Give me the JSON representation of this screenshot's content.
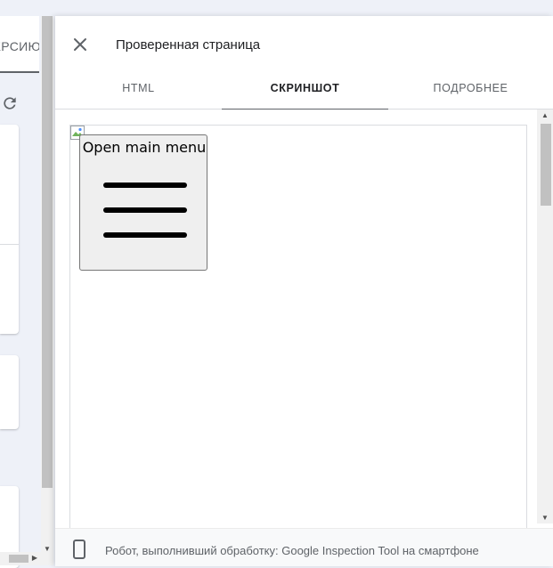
{
  "background_page": {
    "tab_label": "ЕРСИЮ",
    "icons": [
      "refresh-icon"
    ]
  },
  "panel": {
    "title": "Проверенная страница",
    "tabs": [
      {
        "label": "HTML",
        "active": false
      },
      {
        "label": "СКРИНШОТ",
        "active": true
      },
      {
        "label": "ПОДРОБНЕЕ",
        "active": false
      }
    ],
    "screenshot": {
      "menu_button_label": "Open main menu",
      "icons": [
        "broken-image-icon",
        "hamburger-icon"
      ]
    },
    "footer": {
      "text": "Робот, выполнивший обработку: Google Inspection Tool на смартфоне",
      "icon": "smartphone-icon"
    }
  },
  "colors": {
    "background": "#eef1f8",
    "panel": "#ffffff",
    "text_primary": "#202124",
    "text_secondary": "#5f6368",
    "divider": "#dadce0",
    "footer": "#f8f9fa"
  }
}
